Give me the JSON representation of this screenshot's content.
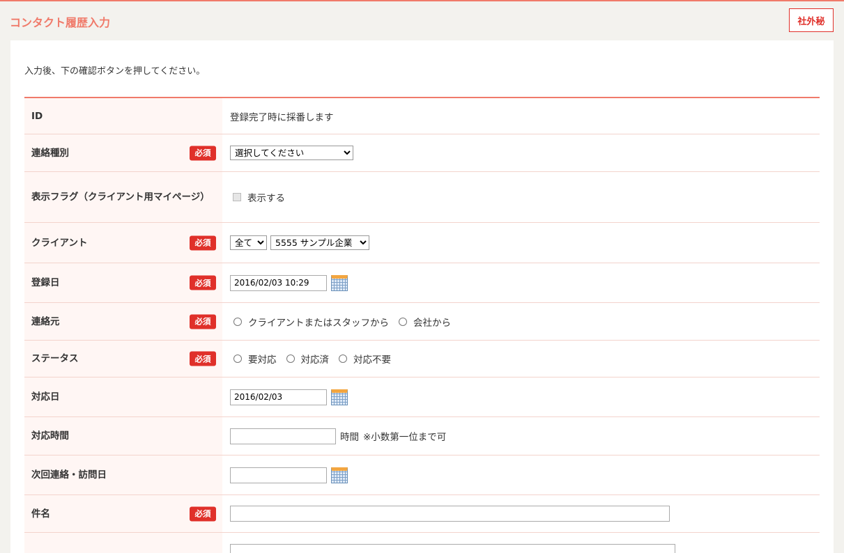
{
  "header": {
    "title": "コンタクト履歴入力",
    "secret_label": "社外秘"
  },
  "intro": "入力後、下の確認ボタンを押してください。",
  "required_label": "必須",
  "fields": {
    "id": {
      "label": "ID",
      "value": "登録完了時に採番します"
    },
    "contact_type": {
      "label": "連絡種別",
      "selected": "選択してください"
    },
    "display_flag": {
      "label": "表示フラグ（クライアント用マイページ）",
      "checkbox_label": "表示する"
    },
    "client": {
      "label": "クライアント",
      "filter_selected": "全て",
      "client_selected": "5555 サンプル企業"
    },
    "registered_date": {
      "label": "登録日",
      "value": "2016/02/03 10:29"
    },
    "contact_source": {
      "label": "連絡元",
      "options": [
        "クライアントまたはスタッフから",
        "会社から"
      ]
    },
    "status": {
      "label": "ステータス",
      "options": [
        "要対応",
        "対応済",
        "対応不要"
      ]
    },
    "response_date": {
      "label": "対応日",
      "value": "2016/02/03"
    },
    "response_time": {
      "label": "対応時間",
      "unit": "時間",
      "note": "※小数第一位まで可"
    },
    "next_contact_date": {
      "label": "次回連絡・訪問日",
      "value": ""
    },
    "subject": {
      "label": "件名",
      "value": ""
    }
  },
  "icons": {
    "calendar": "calendar-icon"
  },
  "colors": {
    "accent": "#f07a6a",
    "required": "#e0302a",
    "label_bg": "#fff6f4"
  }
}
